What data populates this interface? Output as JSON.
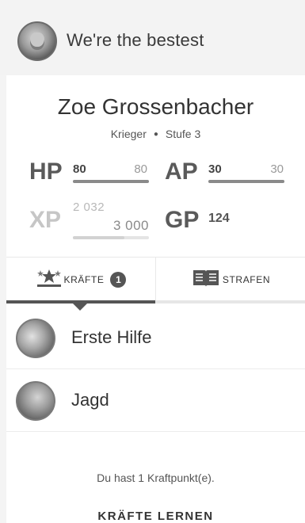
{
  "header": {
    "group_name": "We're the bestest",
    "avatar_icon": "group-crest-icon"
  },
  "character": {
    "name": "Zoe Grossenbacher",
    "class": "Krieger",
    "separator": "●",
    "level": "Stufe 3"
  },
  "stats": {
    "hp": {
      "label": "HP",
      "current": "80",
      "max": "80",
      "fill": 1.0
    },
    "ap": {
      "label": "AP",
      "current": "30",
      "max": "30",
      "fill": 1.0
    },
    "xp": {
      "label": "XP",
      "current": "2 032",
      "max": "3 000",
      "fill": 0.677
    },
    "gp": {
      "label": "GP",
      "value": "124"
    }
  },
  "tabs": [
    {
      "label": "KRÄFTE",
      "badge": "1",
      "icon": "skills-star-icon",
      "active": true
    },
    {
      "label": "STRAFEN",
      "icon": "book-icon",
      "active": false
    }
  ],
  "skills": [
    {
      "name": "Erste Hilfe",
      "icon": "first-aid-icon"
    },
    {
      "name": "Jagd",
      "icon": "hunt-icon"
    }
  ],
  "points_text": "Du hast 1 Kraftpunkt(e).",
  "learn_button": "KRÄFTE LERNEN",
  "colors": {
    "background": "#f4f4f4",
    "card": "#ffffff",
    "accent": "#555555",
    "bar_fill": "#8a8a8a",
    "bar_track": "#e4e4e4"
  }
}
